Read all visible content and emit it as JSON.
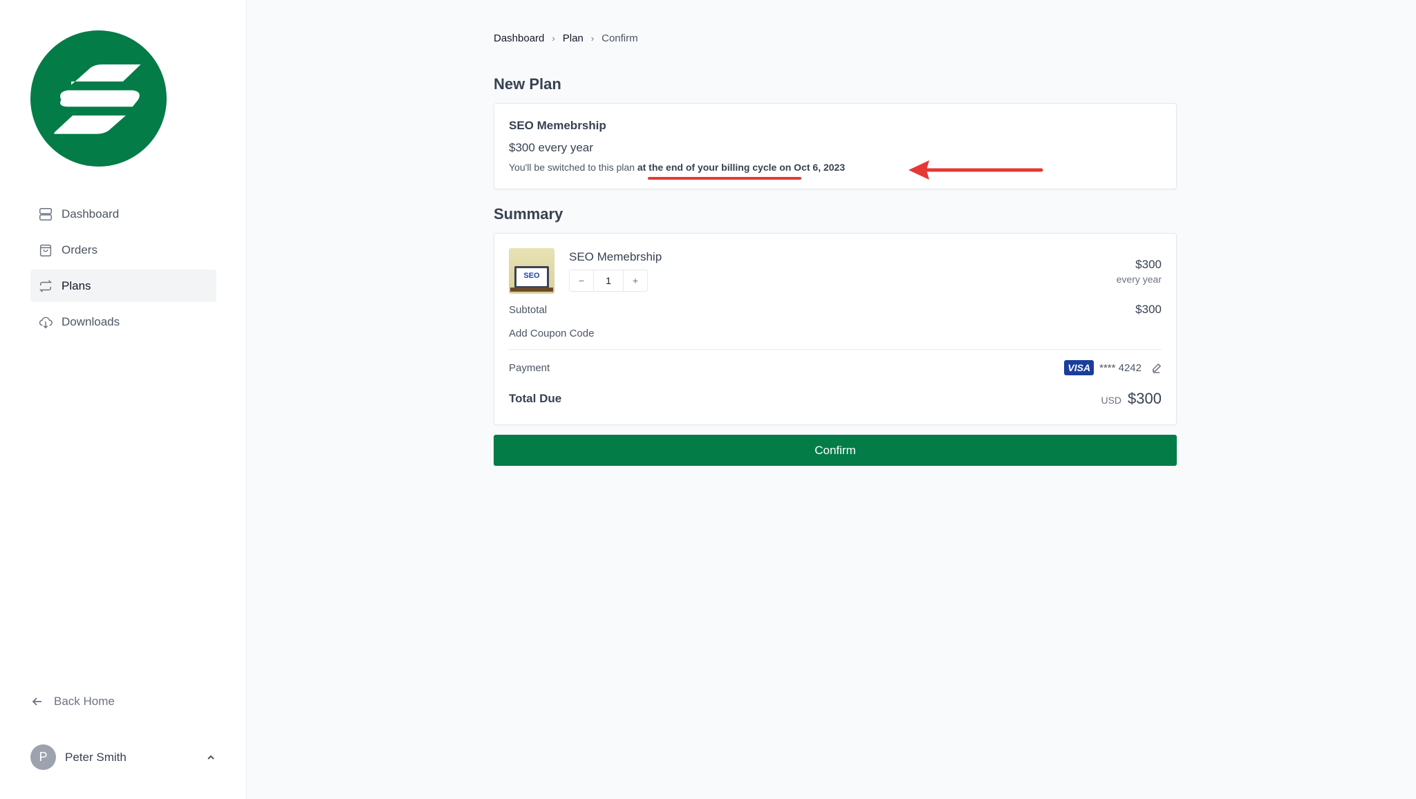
{
  "brand": {
    "color": "#047c48"
  },
  "sidebar": {
    "items": [
      {
        "label": "Dashboard",
        "icon": "server-icon"
      },
      {
        "label": "Orders",
        "icon": "shopping-bag-icon"
      },
      {
        "label": "Plans",
        "icon": "arrows-repeat-icon",
        "active": true
      },
      {
        "label": "Downloads",
        "icon": "cloud-download-icon"
      }
    ],
    "back_home": "Back Home",
    "user": {
      "initial": "P",
      "name": "Peter Smith"
    }
  },
  "breadcrumb": [
    "Dashboard",
    "Plan",
    "Confirm"
  ],
  "new_plan": {
    "heading": "New Plan",
    "name": "SEO Memebrship",
    "price": "$300 every year",
    "notice_prefix": "You'll be switched to this plan ",
    "notice_bold": "at the end of your billing cycle on Oct 6, 2023"
  },
  "summary": {
    "heading": "Summary",
    "product": "SEO Memebrship",
    "thumb_text": "SEO",
    "quantity": "1",
    "price": "$300",
    "period": "every year",
    "subtotal_label": "Subtotal",
    "subtotal": "$300",
    "coupon": "Add Coupon Code",
    "payment_label": "Payment",
    "card_brand": "VISA",
    "card_number": "**** 4242",
    "total_label": "Total Due",
    "currency": "USD",
    "total": "$300"
  },
  "confirm_label": "Confirm",
  "annotation": {
    "color": "#e53935"
  }
}
